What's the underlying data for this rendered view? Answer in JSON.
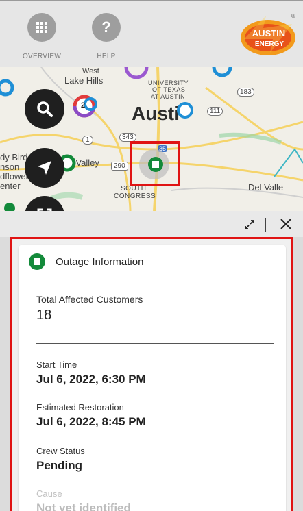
{
  "nav": {
    "overview_label": "OVERVIEW",
    "help_label": "HELP",
    "help_glyph": "?"
  },
  "logo": {
    "line1": "AUSTIN",
    "line2": "ENERGY",
    "mark": "®"
  },
  "map": {
    "labels": {
      "west": "West",
      "lake_hills": "Lake Hills",
      "university": "UNIVERSITY",
      "of_texas": "OF TEXAS",
      "at_austin": "AT AUSTIN",
      "austin": "Austi",
      "hwy_183": "183",
      "hwy_111": "111",
      "hwy_343": "343",
      "hwy_1": "1",
      "hwy_290": "290",
      "hwy_35": "35",
      "valley": "et Valley",
      "south_congress_1": "SOUTH",
      "south_congress_2": "CONGRESS",
      "del_valle": "Del Valle",
      "left_1": "dy Bird",
      "left_2": "nson",
      "left_3": "dflower",
      "left_4": "enter",
      "cluster_count": "2"
    },
    "colors": {
      "outage_green": "#138a3a",
      "highlight_red": "#e01414",
      "marker_blue": "#1f8fd6"
    }
  },
  "outage": {
    "title": "Outage Information",
    "affected_label": "Total Affected Customers",
    "affected_value": "18",
    "start_label": "Start Time",
    "start_value": "Jul 6, 2022, 6:30 PM",
    "restoration_label": "Estimated Restoration",
    "restoration_value": "Jul 6, 2022, 8:45 PM",
    "crew_label": "Crew Status",
    "crew_value": "Pending",
    "cause_label": "Cause",
    "cause_value": "Not yet identified"
  }
}
